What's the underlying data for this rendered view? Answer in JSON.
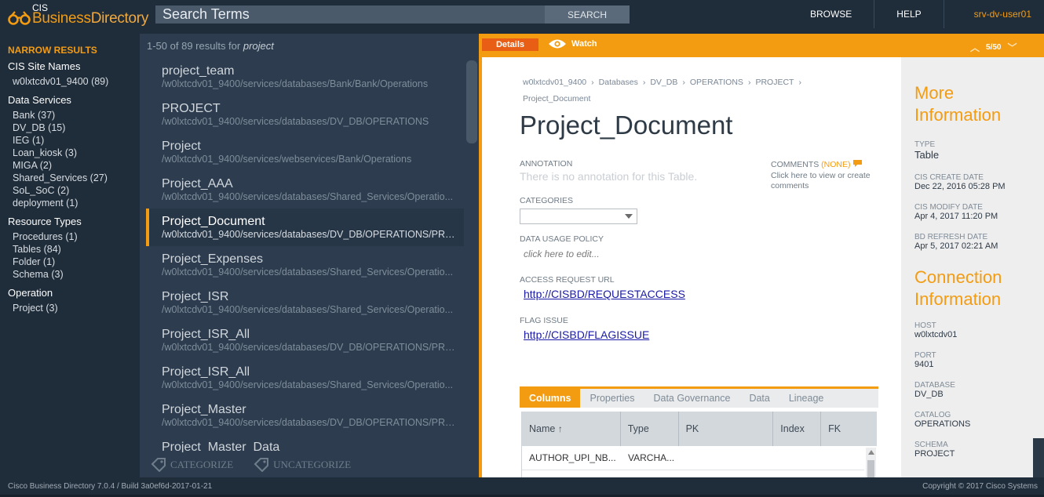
{
  "app": {
    "logo_small": "CIS",
    "logo_business": "Business",
    "logo_directory": "Directory"
  },
  "search": {
    "placeholder": "Search Terms",
    "button": "SEARCH"
  },
  "nav": {
    "browse": "BROWSE",
    "help": "HELP",
    "user": "srv-dv-user01"
  },
  "sidebar": {
    "heading": "NARROW RESULTS",
    "groups": [
      {
        "name": "CIS Site Names",
        "items": [
          "w0lxtcdv01_9400 (89)"
        ]
      },
      {
        "name": "Data Services",
        "items": [
          "Bank (37)",
          "DV_DB (15)",
          "IEG (1)",
          "Loan_kiosk (3)",
          "MIGA (2)",
          "Shared_Services (27)",
          "SoL_SoC (2)",
          "deployment (1)"
        ]
      },
      {
        "name": "Resource Types",
        "items": [
          "Procedures (1)",
          "Tables (84)",
          "Folder (1)",
          "Schema (3)"
        ]
      },
      {
        "name": "Operation",
        "items": [
          "Project (3)"
        ]
      }
    ]
  },
  "results": {
    "summary_prefix": "1-50 of 89 results for",
    "query": "project",
    "items": [
      {
        "title": "project_team",
        "path": "/w0lxtcdv01_9400/services/databases/Bank/Bank/Operations"
      },
      {
        "title": "PROJECT",
        "path": "/w0lxtcdv01_9400/services/databases/DV_DB/OPERATIONS"
      },
      {
        "title": "Project",
        "path": "/w0lxtcdv01_9400/services/webservices/Bank/Operations"
      },
      {
        "title": "Project_AAA",
        "path": "/w0lxtcdv01_9400/services/databases/Shared_Services/Operatio..."
      },
      {
        "title": "Project_Document",
        "path": "/w0lxtcdv01_9400/services/databases/DV_DB/OPERATIONS/PRO..."
      },
      {
        "title": "Project_Expenses",
        "path": "/w0lxtcdv01_9400/services/databases/Shared_Services/Operatio..."
      },
      {
        "title": "Project_ISR",
        "path": "/w0lxtcdv01_9400/services/databases/Shared_Services/Operatio..."
      },
      {
        "title": "Project_ISR_All",
        "path": "/w0lxtcdv01_9400/services/databases/DV_DB/OPERATIONS/PRO..."
      },
      {
        "title": "Project_ISR_All",
        "path": "/w0lxtcdv01_9400/services/databases/Shared_Services/Operatio..."
      },
      {
        "title": "Project_Master",
        "path": "/w0lxtcdv01_9400/services/databases/DV_DB/OPERATIONS/PRO..."
      },
      {
        "title": "Project_Master_Data",
        "path": ""
      }
    ],
    "categorize": "CATEGORIZE",
    "uncategorize": "UNCATEGORIZE"
  },
  "detail_bar": {
    "details_tab": "Details",
    "watch": "Watch",
    "pager": "5/50"
  },
  "detail": {
    "breadcrumb": [
      "w0lxtcdv01_9400",
      "Databases",
      "DV_DB",
      "OPERATIONS",
      "PROJECT",
      "Project_Document"
    ],
    "title": "Project_Document",
    "annotation_label": "ANNOTATION",
    "annotation_value": "There is no annotation for this Table.",
    "comments_label": "COMMENTS",
    "comments_none": "(NONE)",
    "comments_value": "Click here to view or create comments",
    "categories_label": "CATEGORIES",
    "data_usage_label": "DATA USAGE POLICY",
    "data_usage_value": "click here to edit...",
    "access_label": "ACCESS REQUEST URL",
    "access_url": "http://CISBD/REQUESTACCESS",
    "flag_label": "FLAG ISSUE",
    "flag_url": "http://CISBD/FLAGISSUE",
    "tabs": [
      "Columns",
      "Properties",
      "Data Governance",
      "Data",
      "Lineage"
    ],
    "grid_headers": [
      "Name",
      "Type",
      "PK",
      "Index",
      "FK"
    ],
    "grid_rows": [
      {
        "name": "AUTHOR_UPI_NB...",
        "type": "VARCHA..."
      }
    ]
  },
  "more_info": {
    "heading_1": "More",
    "heading_2": "Information",
    "type_label": "TYPE",
    "type_value": "Table",
    "create_label": "CIS CREATE DATE",
    "create_value": "Dec 22, 2016 05:28 PM",
    "modify_label": "CIS MODIFY DATE",
    "modify_value": "Apr 4, 2017 11:20 PM",
    "refresh_label": "BD REFRESH DATE",
    "refresh_value": "Apr 5, 2017 02:21 AM",
    "conn_heading_1": "Connection",
    "conn_heading_2": "Information",
    "host_label": "HOST",
    "host_value": "w0lxtcdv01",
    "port_label": "PORT",
    "port_value": "9401",
    "db_label": "DATABASE",
    "db_value": "DV_DB",
    "catalog_label": "CATALOG",
    "catalog_value": "OPERATIONS",
    "schema_label": "SCHEMA",
    "schema_value": "PROJECT"
  },
  "footer": {
    "left": "Cisco Business Directory 7.0.4 / Build 3a0ef6d-2017-01-21",
    "right": "Copyright © 2017 Cisco Systems"
  },
  "colors": {
    "accent": "#f39c12",
    "bg_dark": "#1f2c39",
    "panel": "#2d3d4f",
    "link": "#1a1aa6"
  }
}
